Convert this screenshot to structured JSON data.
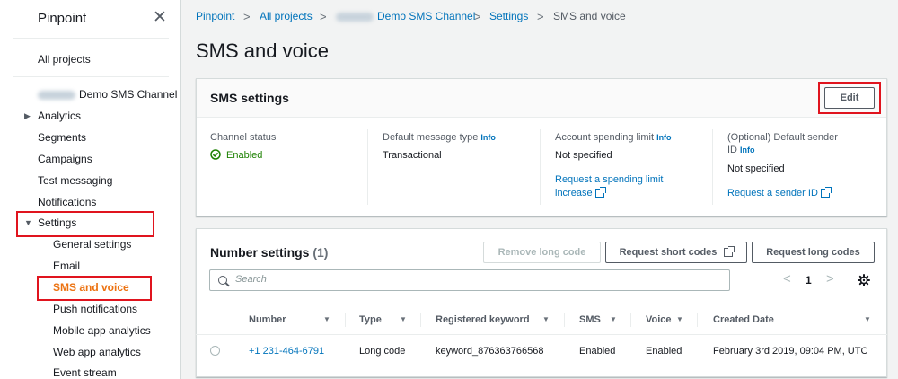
{
  "sidebar": {
    "title": "Pinpoint",
    "close_glyph": "✕",
    "all_projects": "All projects",
    "project_name": "Demo SMS Channel",
    "items": {
      "analytics": "Analytics",
      "segments": "Segments",
      "campaigns": "Campaigns",
      "test_messaging": "Test messaging",
      "notifications": "Notifications",
      "settings": "Settings",
      "general_settings": "General settings",
      "email": "Email",
      "sms_and_voice": "SMS and voice",
      "push_notifications": "Push notifications",
      "mobile_app_analytics": "Mobile app analytics",
      "web_app_analytics": "Web app analytics",
      "event_stream": "Event stream"
    }
  },
  "breadcrumb": {
    "pinpoint": "Pinpoint",
    "all_projects": "All projects",
    "project": "Demo SMS Channel",
    "settings": "Settings",
    "current": "SMS and voice",
    "separator": ">"
  },
  "page": {
    "title": "SMS and voice"
  },
  "sms_settings": {
    "title": "SMS settings",
    "edit_label": "Edit",
    "info_label": "Info",
    "channel_status_label": "Channel status",
    "channel_status_value": "Enabled",
    "default_message_type_label": "Default message type",
    "default_message_type_value": "Transactional",
    "spending_limit_label": "Account spending limit",
    "spending_limit_value": "Not specified",
    "spending_limit_link_1": "Request a spending limit",
    "spending_limit_link_2": "increase",
    "sender_id_label_1": "(Optional) Default sender",
    "sender_id_label_2": "ID",
    "sender_id_value": "Not specified",
    "sender_id_link": "Request a sender ID"
  },
  "number_settings": {
    "title": "Number settings",
    "count": "(1)",
    "remove_label": "Remove long code",
    "short_codes_label": "Request short codes",
    "long_codes_label": "Request long codes",
    "search_placeholder": "Search",
    "page": "1",
    "prev_glyph": "<",
    "next_glyph": ">",
    "columns": {
      "number": "Number",
      "type": "Type",
      "keyword": "Registered keyword",
      "sms": "SMS",
      "voice": "Voice",
      "created": "Created Date"
    },
    "rows": [
      {
        "number": "+1 231-464-6791",
        "type": "Long code",
        "keyword": "keyword_876363766568",
        "sms": "Enabled",
        "voice": "Enabled",
        "created": "February 3rd 2019, 09:04 PM, UTC"
      }
    ]
  },
  "colors": {
    "accent": "#ec7211",
    "link": "#0073bb",
    "success": "#1d8102",
    "highlight": "#e0141e"
  },
  "icons": {
    "close": "close-icon",
    "expand": "caret-right-icon",
    "collapse": "caret-down-icon",
    "status": "check-circle-icon",
    "external": "external-link-icon",
    "search": "search-icon",
    "settings": "gear-icon",
    "sort": "sort-down-icon"
  }
}
